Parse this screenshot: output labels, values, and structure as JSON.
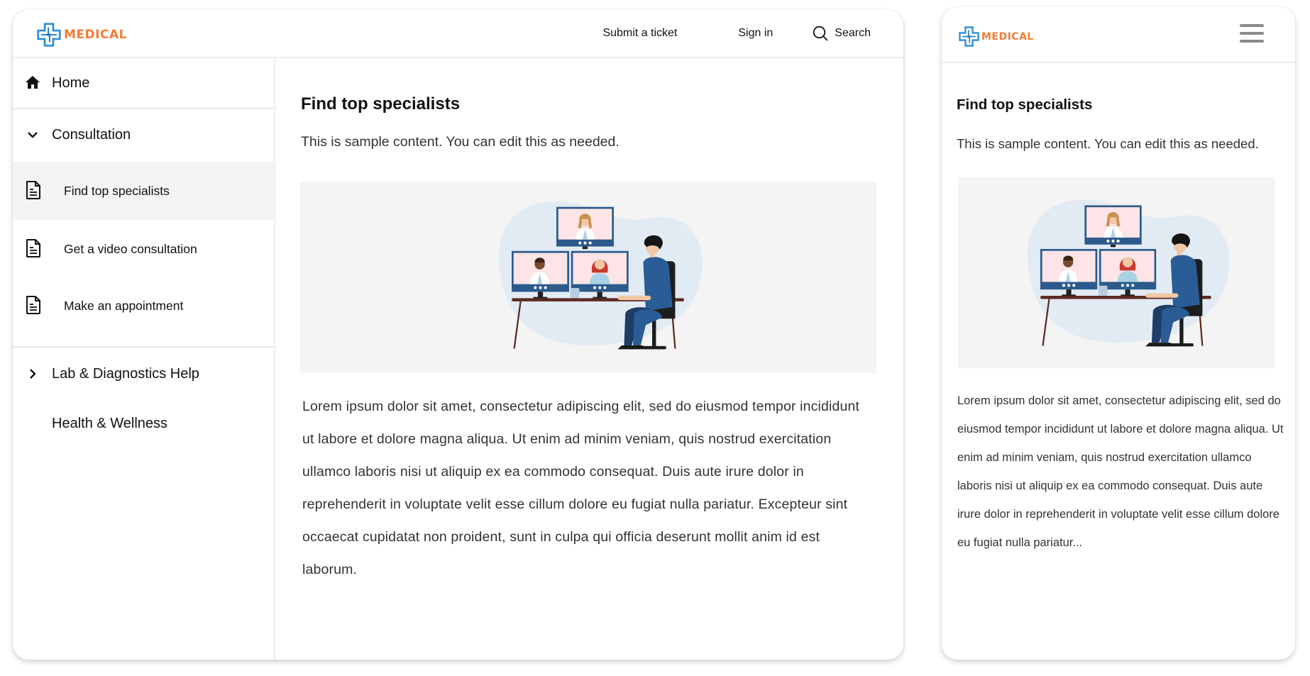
{
  "brand": {
    "name": "MEDICAL",
    "colors": {
      "accent": "#f47a35",
      "logo_blue": "#2b8fd6",
      "illustration_navy": "#2c5a8c"
    }
  },
  "desktop": {
    "nav": {
      "submit_ticket": "Submit a ticket",
      "sign_in": "Sign in",
      "search": "Search",
      "search_icon": "search-icon"
    },
    "sidebar": {
      "items": [
        {
          "label": "Home",
          "icon": "home-icon",
          "level": "top"
        },
        {
          "label": "Consultation",
          "icon": "chevron-down-icon",
          "level": "top",
          "expanded": true
        },
        {
          "label": "Find top specialists",
          "icon": "document-icon",
          "level": "sub",
          "active": true
        },
        {
          "label": "Get a video consultation",
          "icon": "document-icon",
          "level": "sub"
        },
        {
          "label": "Make an appointment",
          "icon": "document-icon",
          "level": "sub"
        },
        {
          "label": "Lab & Diagnostics Help",
          "icon": "chevron-right-icon",
          "level": "top",
          "expanded": false
        },
        {
          "label": "Health & Wellness",
          "level": "top"
        }
      ]
    },
    "content": {
      "title": "Find top specialists",
      "subtitle": "This is sample content. You can edit this as needed.",
      "illustration": "video-consultation-illustration",
      "body": "Lorem ipsum dolor sit amet, consectetur adipiscing elit, sed do eiusmod tempor incididunt ut labore et dolore magna aliqua. Ut enim ad minim veniam, quis nostrud exercitation ullamco laboris nisi ut aliquip ex ea commodo consequat. Duis aute irure dolor in reprehenderit in voluptate velit esse cillum dolore eu fugiat nulla pariatur. Excepteur sint occaecat cupidatat non proident, sunt in culpa qui officia deserunt mollit anim id est laborum."
    }
  },
  "mobile": {
    "menu_icon": "hamburger-menu-icon",
    "content": {
      "title": "Find top specialists",
      "subtitle": "This is sample content. You can edit this as needed.",
      "illustration": "video-consultation-illustration",
      "body": "Lorem ipsum dolor sit amet, consectetur adipiscing elit, sed do eiusmod tempor incididunt ut labore et dolore magna aliqua. Ut enim ad minim veniam, quis nostrud exercitation ullamco laboris nisi ut aliquip ex ea commodo consequat. Duis aute irure dolor in reprehenderit in voluptate velit esse cillum dolore eu fugiat nulla pariatur..."
    }
  }
}
